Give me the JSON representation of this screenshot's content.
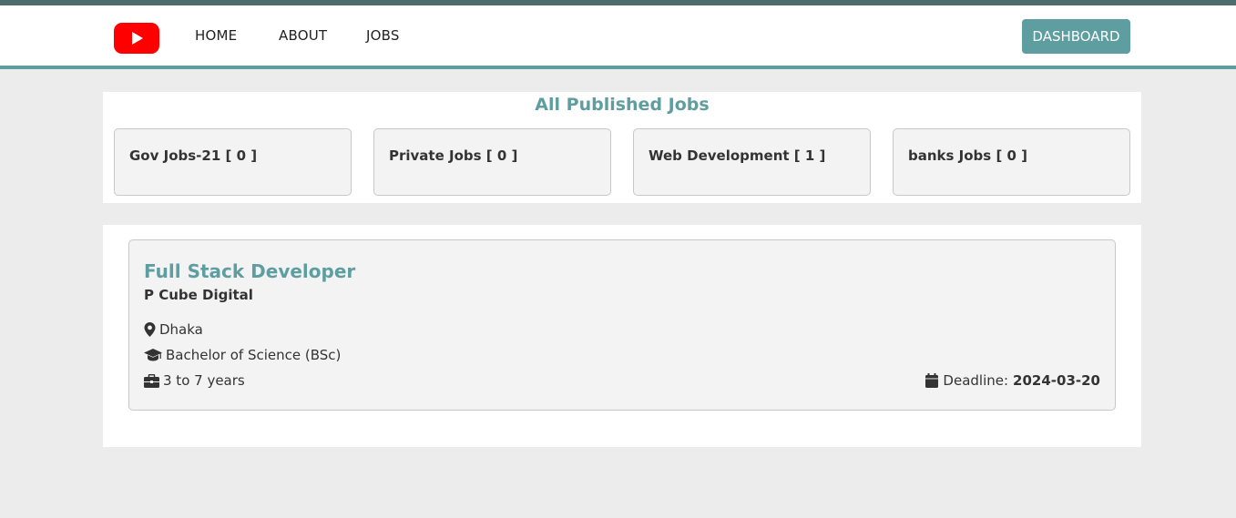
{
  "nav": {
    "links": [
      "HOME",
      "ABOUT",
      "JOBS"
    ],
    "dashboard_label": "DASHBOARD",
    "accent_color": "#5f9ea0",
    "logo_icon": "youtube-play-icon"
  },
  "categories": {
    "title": "All Published Jobs",
    "items": [
      {
        "label": "Gov Jobs-21 [ 0 ]"
      },
      {
        "label": "Private Jobs [ 0 ]"
      },
      {
        "label": "Web Development [ 1 ]"
      },
      {
        "label": "banks Jobs [ 0 ]"
      }
    ]
  },
  "jobs": [
    {
      "title": "Full Stack Developer",
      "company": "P Cube Digital",
      "location": "Dhaka",
      "education": "Bachelor of Science (BSc)",
      "experience": "3 to 7 years",
      "deadline_label": "Deadline:",
      "deadline": "2024-03-20",
      "icons": {
        "location": "map-marker-icon",
        "education": "graduation-cap-icon",
        "experience": "briefcase-icon",
        "deadline": "calendar-icon"
      }
    }
  ]
}
